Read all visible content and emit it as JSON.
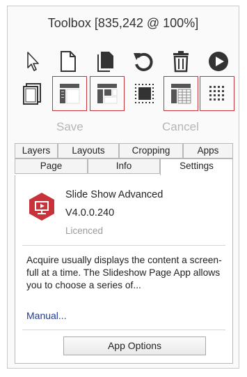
{
  "window": {
    "title": "Toolbox [835,242 @ 100%]"
  },
  "toolbar": {
    "row1": [
      {
        "icon": "pointer-icon"
      },
      {
        "icon": "new-page-icon"
      },
      {
        "icon": "copy-page-icon"
      },
      {
        "icon": "rotate-icon"
      },
      {
        "icon": "trash-icon"
      },
      {
        "icon": "play-icon"
      }
    ],
    "row2": [
      {
        "icon": "page-frame-icon"
      },
      {
        "icon": "layout-top-left-icon"
      },
      {
        "icon": "layout-split-icon"
      },
      {
        "icon": "dotted-square-icon"
      },
      {
        "icon": "layout-grid-icon"
      },
      {
        "icon": "dot-grid-icon"
      }
    ],
    "save_label": "Save",
    "cancel_label": "Cancel",
    "highlight_color": "#c8323a"
  },
  "tabs": {
    "top": [
      "Layers",
      "Layouts",
      "Cropping",
      "Apps"
    ],
    "bottom": [
      "Page",
      "Info",
      "Settings"
    ],
    "active": "Settings"
  },
  "app": {
    "icon": "slideshow-app-icon",
    "icon_color": "#c8323a",
    "name": "Slide Show Advanced",
    "version": "V4.0.0.240",
    "license": "Licenced",
    "description": "Acquire usually displays the content a screen-full at a time. The Slideshow Page App allows you to choose a series of...",
    "manual_link": "Manual...",
    "options_button": "App Options"
  }
}
